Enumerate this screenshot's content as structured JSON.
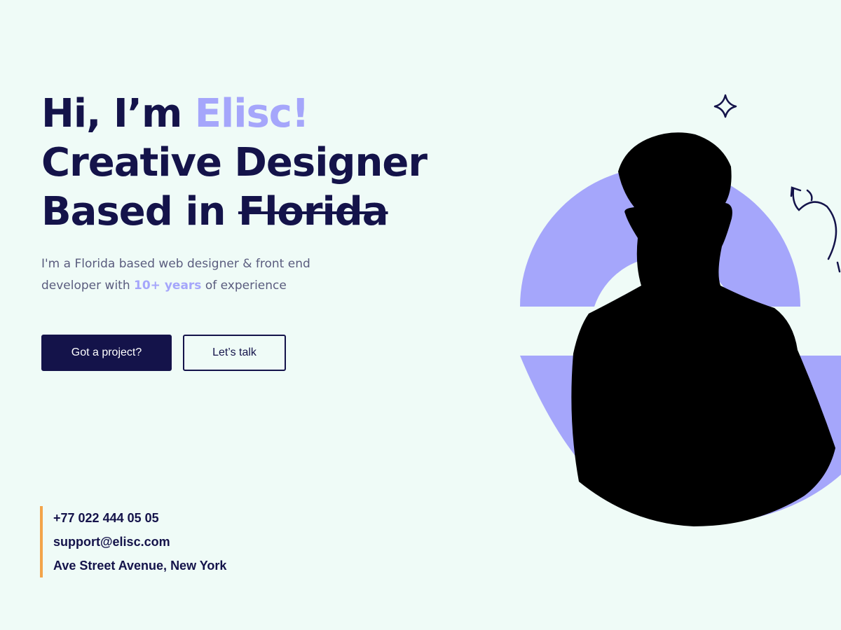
{
  "hero": {
    "greeting": "Hi, I’m ",
    "name": "Elisc!",
    "title_line": "Creative Designer",
    "based_prefix": "Based in ",
    "city": "Florida"
  },
  "intro": {
    "part1": "I'm a Florida based web designer & front  end developer with ",
    "highlight": "10+ years",
    "part2": " of experience"
  },
  "buttons": {
    "primary_label": "Got a project?",
    "secondary_label": "Let’s talk"
  },
  "contact": {
    "phone": "+77 022 444 05 05",
    "email": "support@elisc.com",
    "address": "Ave Street Avenue, New York"
  },
  "icons": {
    "sparkle": "sparkle-icon",
    "arrow": "curly-arrow-icon"
  },
  "colors": {
    "background": "#effbf7",
    "navy": "#14134a",
    "accent_lavender": "#a5a6fb",
    "contact_bar": "#f3a44a",
    "body_text": "#5a5c7e"
  }
}
